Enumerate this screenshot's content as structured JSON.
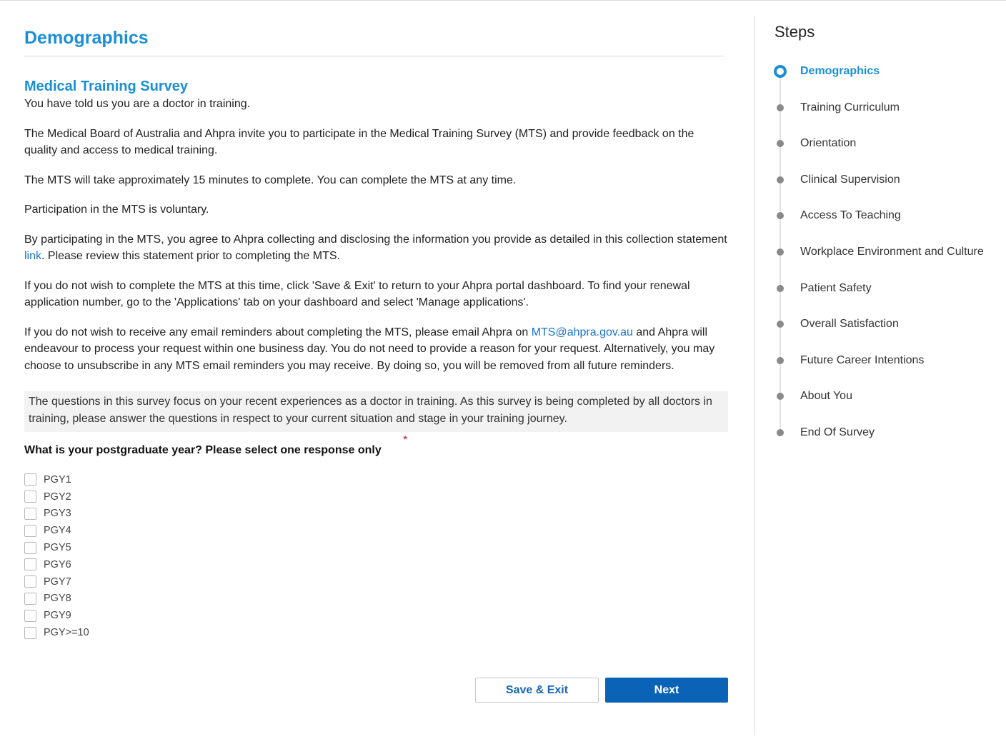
{
  "page": {
    "title": "Demographics"
  },
  "intro": {
    "section_title": "Medical Training Survey",
    "p1": "You have told us you are a doctor in training.",
    "p2": "The Medical Board of Australia and Ahpra invite you to participate in the Medical Training Survey (MTS) and provide feedback on the quality and access to medical training.",
    "p3": "The MTS will take approximately 15 minutes to complete. You can complete the MTS at any time.",
    "p4": "Participation in the MTS is voluntary.",
    "p5_before": "By participating in the MTS, you agree to Ahpra collecting and disclosing the information you provide as detailed in this collection statement ",
    "p5_link": "link",
    "p5_after": ". Please review this statement prior to completing the MTS.",
    "p6": "If you do not wish to complete the MTS at this time, click 'Save & Exit' to return to your Ahpra portal dashboard. To find your renewal application number, go to the 'Applications' tab on your dashboard and select 'Manage applications'.",
    "p7_before": "If you do not wish to receive any email reminders about completing the MTS, please email Ahpra on ",
    "p7_email": "MTS@ahpra.gov.au",
    "p7_after": " and Ahpra will endeavour to process your request within one business day. You do not need to provide a reason for your request. Alternatively, you may choose to unsubscribe in any MTS email reminders you may receive. By doing so, you will be removed from all future reminders."
  },
  "notice": "The questions in this survey focus on your recent experiences as a doctor in training. As this survey is being completed by all doctors in training, please answer the questions in respect to your current situation and stage in your training journey.",
  "question": {
    "label": "What is your postgraduate year? Please select one response only",
    "required_mark": "*",
    "options": [
      "PGY1",
      "PGY2",
      "PGY3",
      "PGY4",
      "PGY5",
      "PGY6",
      "PGY7",
      "PGY8",
      "PGY9",
      "PGY>=10"
    ]
  },
  "actions": {
    "save_exit": "Save & Exit",
    "next": "Next"
  },
  "steps": {
    "title": "Steps",
    "items": [
      {
        "label": "Demographics",
        "active": true
      },
      {
        "label": "Training Curriculum",
        "active": false
      },
      {
        "label": "Orientation",
        "active": false
      },
      {
        "label": "Clinical Supervision",
        "active": false
      },
      {
        "label": "Access To Teaching",
        "active": false
      },
      {
        "label": "Workplace Environment and Culture",
        "active": false
      },
      {
        "label": "Patient Safety",
        "active": false
      },
      {
        "label": "Overall Satisfaction",
        "active": false
      },
      {
        "label": "Future Career Intentions",
        "active": false
      },
      {
        "label": "About You",
        "active": false
      },
      {
        "label": "End Of Survey",
        "active": false
      }
    ]
  },
  "colors": {
    "accent": "#1a8fd6",
    "primary_button": "#0b63b8",
    "required": "#c8102e",
    "notice_bg": "#f2f2f2"
  }
}
